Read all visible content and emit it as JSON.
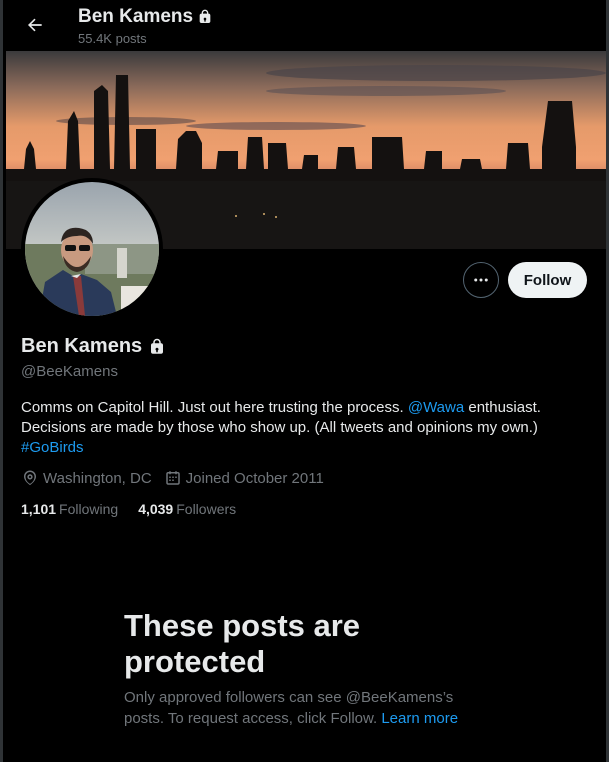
{
  "header": {
    "back_icon": "arrow-left-icon",
    "name": "Ben Kamens",
    "posts_count": "55.4K posts"
  },
  "profile": {
    "display_name": "Ben Kamens",
    "locked": true,
    "handle": "@BeeKamens",
    "bio": {
      "part1": "Comms on Capitol Hill. Just out here trusting the process. ",
      "mention": "@Wawa",
      "part2": " enthusiast. Decisions are made by those who show up. (All tweets and opinions my own.) ",
      "hashtag": "#GoBirds"
    },
    "location": "Washington, DC",
    "joined": "Joined October 2011",
    "following_count": "1,101",
    "following_label": "Following",
    "followers_count": "4,039",
    "followers_label": "Followers"
  },
  "actions": {
    "more_icon": "more-dots-icon",
    "follow_label": "Follow"
  },
  "protected": {
    "title": "These posts are protected",
    "body": "Only approved followers can see @BeeKamens’s posts. To request access, click Follow. ",
    "learn_more": "Learn more"
  },
  "colors": {
    "background": "#000000",
    "accent": "#1d9bf0",
    "muted": "#71767b",
    "text": "#e7e9ea"
  }
}
